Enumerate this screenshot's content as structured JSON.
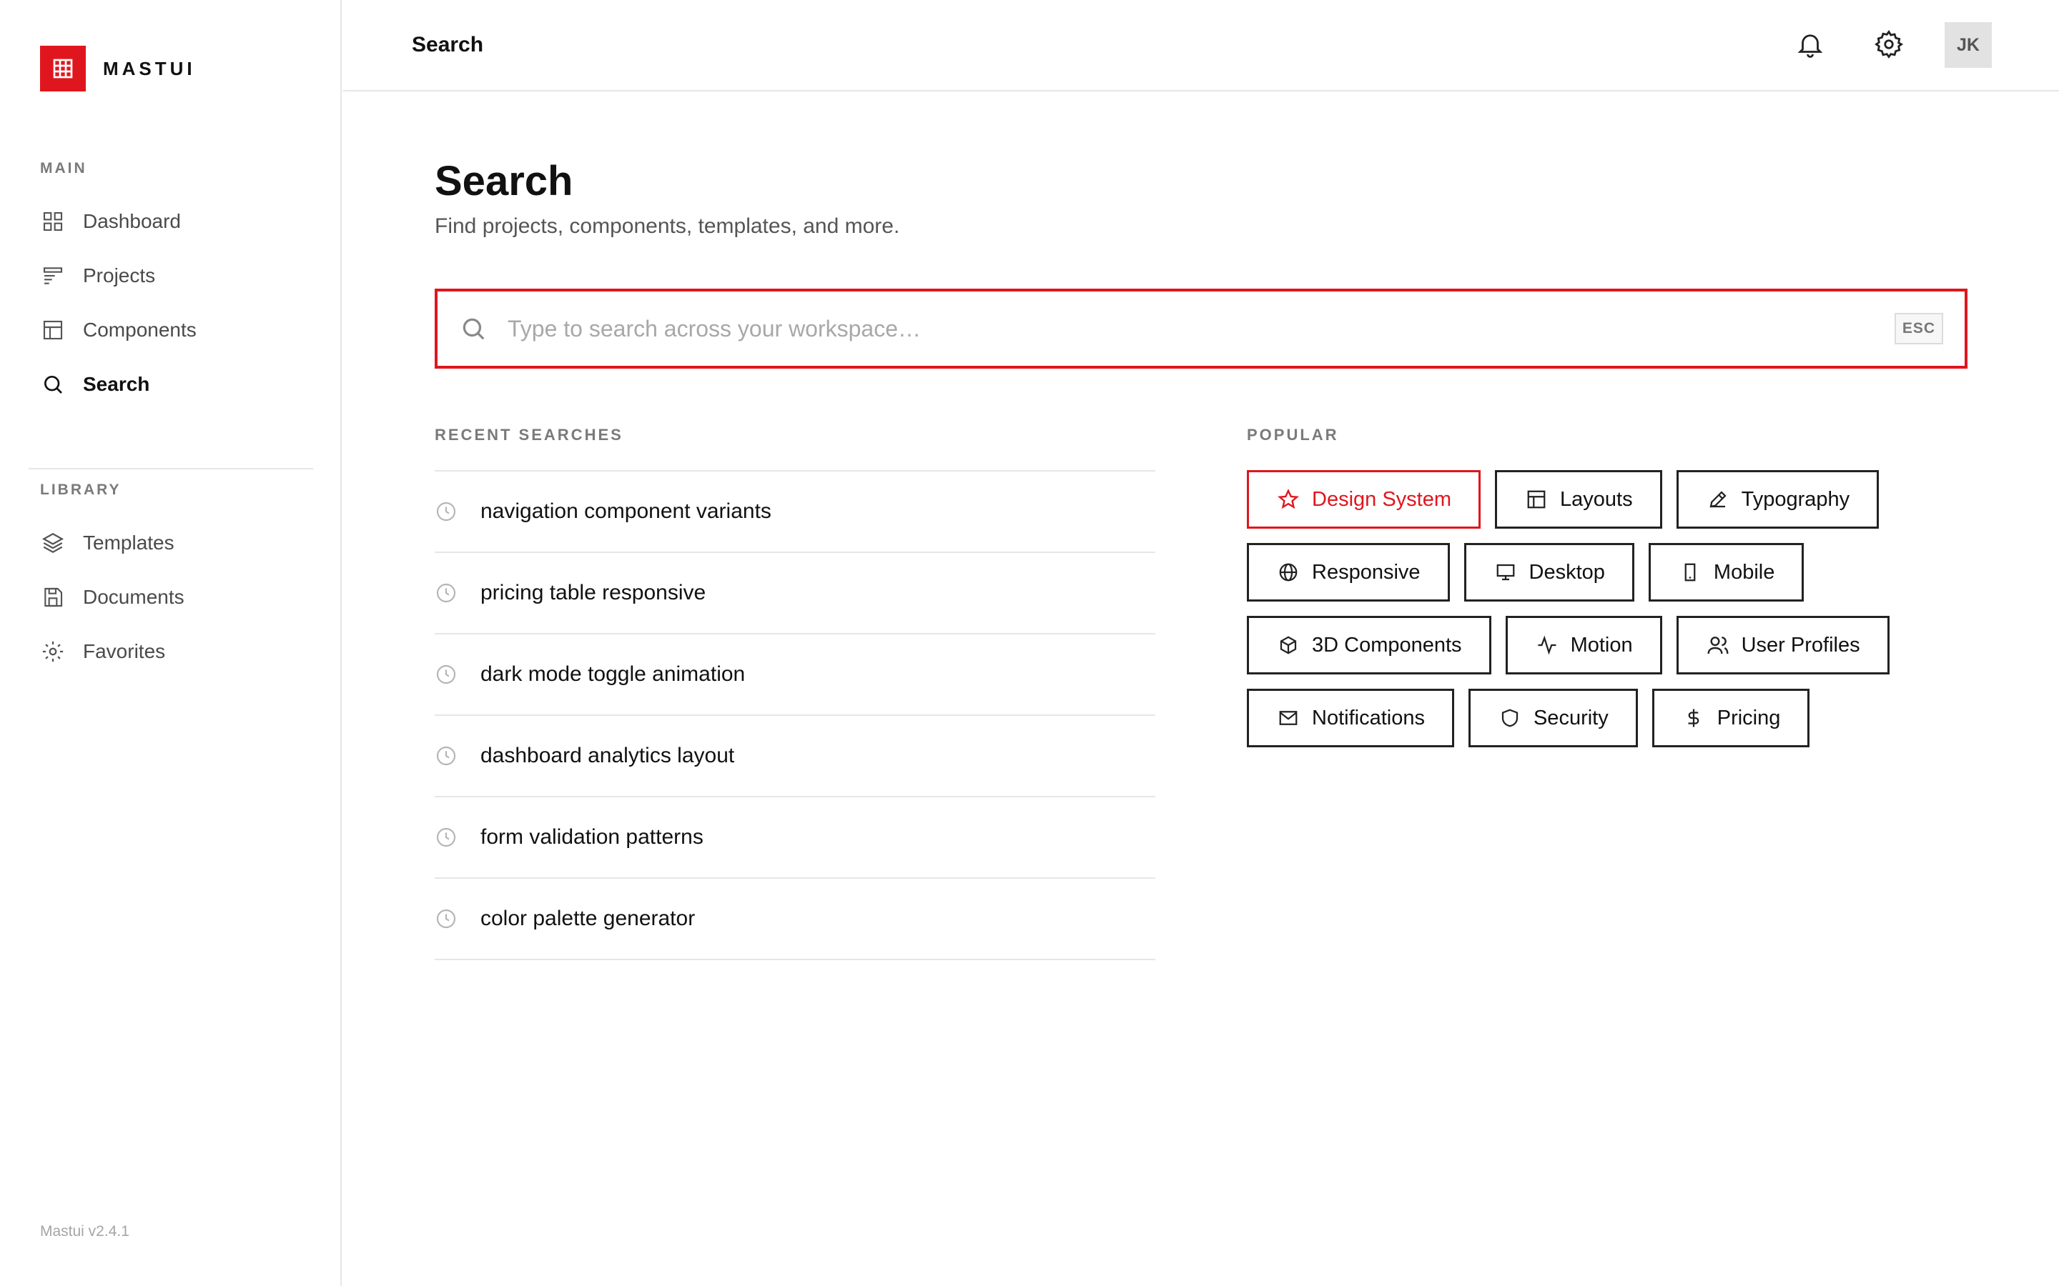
{
  "app": {
    "brand": "MASTUI",
    "version": "Mastui v2.4.1",
    "accent": "#e0161e"
  },
  "sidebar": {
    "main_label": "MAIN",
    "library_label": "LIBRARY",
    "main_items": [
      {
        "label": "Dashboard",
        "icon": "grid-icon",
        "active": false
      },
      {
        "label": "Projects",
        "icon": "projects-icon",
        "active": false
      },
      {
        "label": "Components",
        "icon": "layout-icon",
        "active": false
      },
      {
        "label": "Search",
        "icon": "search-icon",
        "active": true
      }
    ],
    "library_items": [
      {
        "label": "Templates",
        "icon": "layers-icon"
      },
      {
        "label": "Documents",
        "icon": "save-icon"
      },
      {
        "label": "Favorites",
        "icon": "sun-icon"
      }
    ]
  },
  "topbar": {
    "title": "Search",
    "avatar_initials": "JK"
  },
  "main": {
    "title": "Search",
    "subtitle": "Find projects, components, templates, and more.",
    "search": {
      "placeholder": "Type to search across your workspace…",
      "value": "",
      "esc_label": "ESC"
    },
    "recent_label": "RECENT SEARCHES",
    "recent": [
      "navigation component variants",
      "pricing table responsive",
      "dark mode toggle animation",
      "dashboard analytics layout",
      "form validation patterns",
      "color palette generator"
    ],
    "popular_label": "POPULAR",
    "popular": [
      {
        "label": "Design System",
        "icon": "star-icon",
        "featured": true
      },
      {
        "label": "Layouts",
        "icon": "layout-icon"
      },
      {
        "label": "Typography",
        "icon": "pencil-icon"
      },
      {
        "label": "Responsive",
        "icon": "globe-icon"
      },
      {
        "label": "Desktop",
        "icon": "monitor-icon"
      },
      {
        "label": "Mobile",
        "icon": "smartphone-icon"
      },
      {
        "label": "3D Components",
        "icon": "cube-icon"
      },
      {
        "label": "Motion",
        "icon": "activity-icon"
      },
      {
        "label": "User Profiles",
        "icon": "users-icon"
      },
      {
        "label": "Notifications",
        "icon": "mail-icon"
      },
      {
        "label": "Security",
        "icon": "shield-icon"
      },
      {
        "label": "Pricing",
        "icon": "dollar-icon"
      }
    ]
  }
}
